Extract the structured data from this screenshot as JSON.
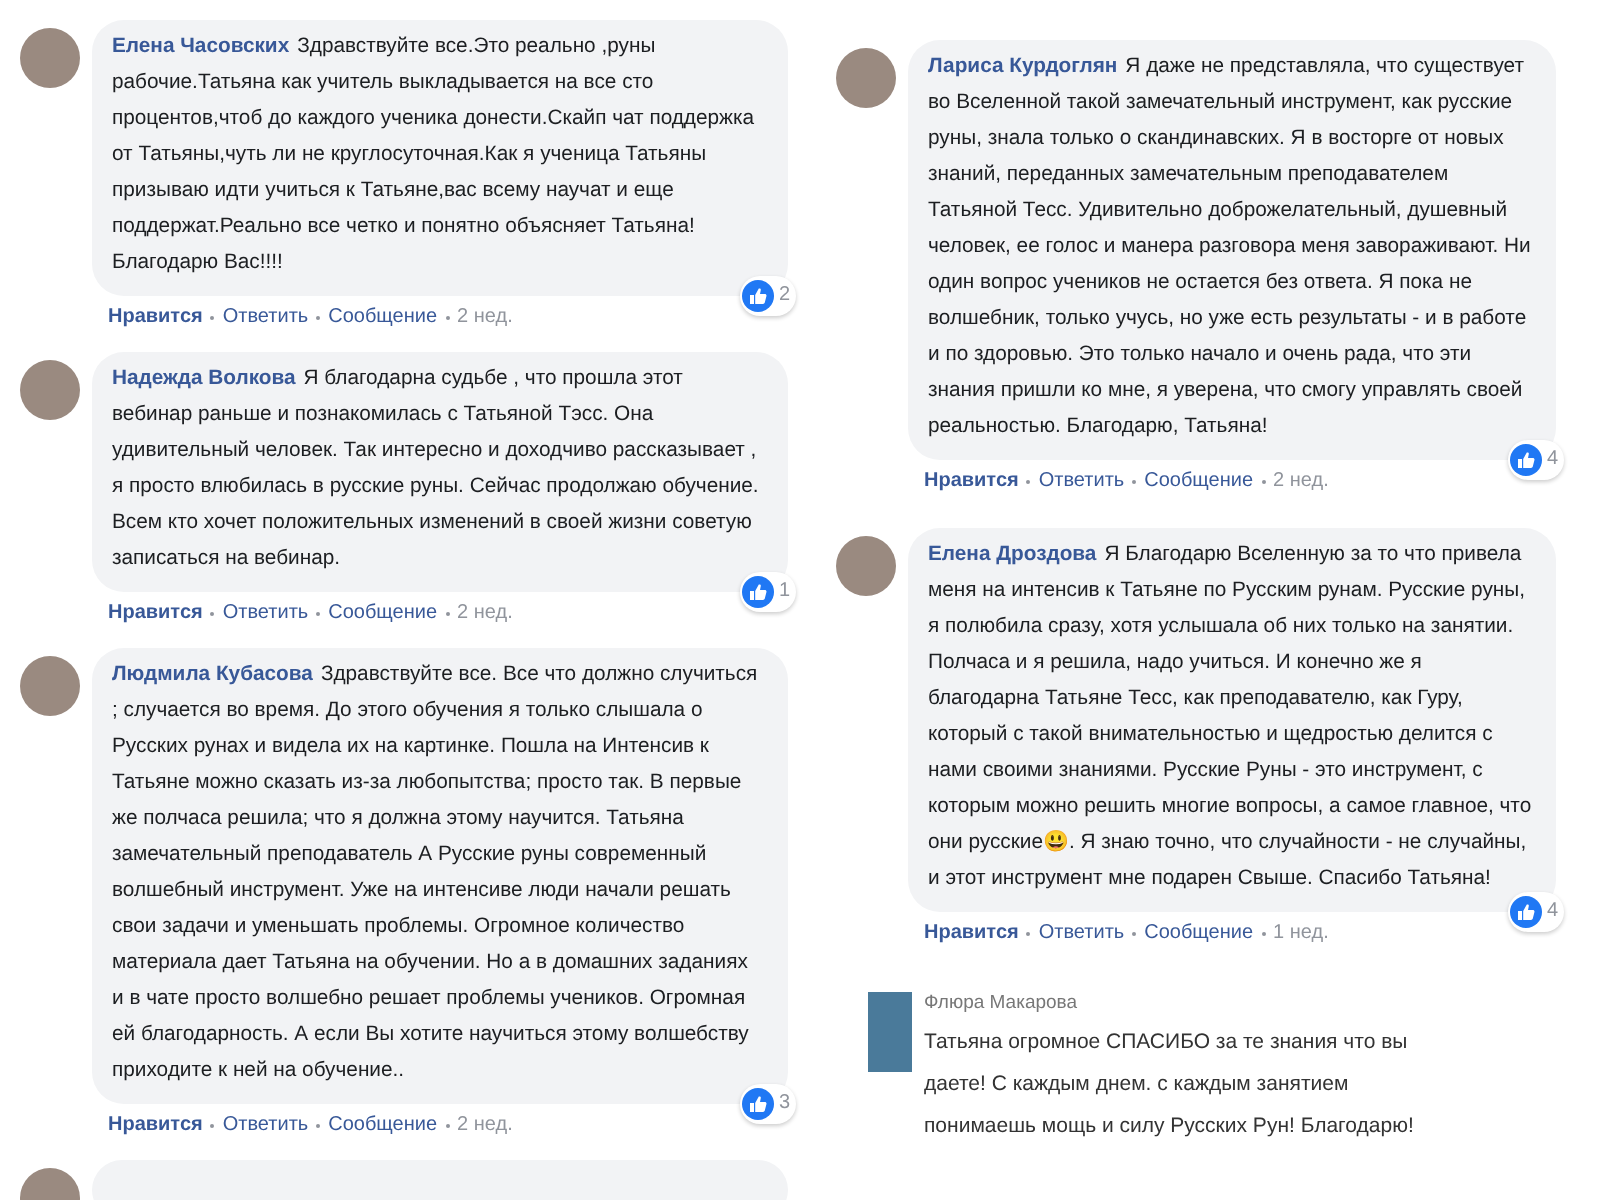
{
  "columns": [
    {
      "comments": [
        {
          "kind": "bubble",
          "author": "Елена Часовских",
          "text": "Здравствуйте все.Это реально ,руны рабочие.Татьяна как учитель выкладывается на все сто процентов,чтоб до каждого ученика донести.Скайп чат поддержка от Татьяны,чуть ли не круглосуточная.Как я ученица Татьяны призываю идти учиться к Татьяне,вас всему научат и еще поддержат.Реально все четко и понятно объясняет Татьяна! Благодарю Вас!!!!",
          "reactions": "2",
          "actions": [
            "Нравится",
            "Ответить",
            "Сообщение"
          ],
          "time": "2 нед."
        },
        {
          "kind": "bubble",
          "author": "Надежда Волкова",
          "text": "Я благодарна судьбе , что прошла этот вебинар раньше и познакомилась с Татьяной Тэсс. Она удивительный человек. Так интересно и доходчиво рассказывает , я просто влюбилась в русские руны. Сейчас продолжаю обучение. Всем кто хочет положительных изменений в своей жизни советую записаться на вебинар.",
          "reactions": "1",
          "actions": [
            "Нравится",
            "Ответить",
            "Сообщение"
          ],
          "time": "2 нед."
        },
        {
          "kind": "bubble",
          "author": "Людмила Кубасова",
          "text": "Здравствуйте все. Все что должно случиться ; случается во время. До этого обучения я только слышала о Русских рунах и видела их на картинке. Пошла на Интенсив к Татьяне можно сказать из-за любопытства; просто так. В первые же полчаса решила; что я должна этому научится. Татьяна замечательный преподаватель А Русские руны современный волшебный инструмент. Уже на интенсиве люди начали решать свои задачи и уменьшать проблемы. Огромное количество материала дает Татьяна на обучении. Но а в домашних заданиях и в чате просто волшебно решает проблемы учеников. Огромная ей благодарность. А если Вы хотите научиться этому волшебству приходите к ней на обучение..",
          "reactions": "3",
          "actions": [
            "Нравится",
            "Ответить",
            "Сообщение"
          ],
          "time": "2 нед."
        },
        {
          "kind": "cut"
        }
      ]
    },
    {
      "comments": [
        {
          "kind": "bubble",
          "author": "Лариса Курдоглян",
          "text": "Я даже не представляла, что существует во Вселенной такой замечательный инструмент, как русские руны, знала только о скандинавских. Я в восторге от новых знаний, переданных замечательным преподавателем Татьяной Тесс. Удивительно доброжелательный, душевный человек, ее голос и манера разговора меня завораживают. Ни один вопрос учеников не остается без ответа. Я пока не волшебник, только учусь, но уже есть результаты - и в работе и по здоровью. Это только начало и очень рада, что эти знания пришли ко мне, я уверена, что смогу управлять своей реальностью. Благодарю, Татьяна!",
          "reactions": "4",
          "actions": [
            "Нравится",
            "Ответить",
            "Сообщение"
          ],
          "time": "2 нед."
        },
        {
          "kind": "bubble",
          "author": "Елена Дроздова",
          "text": "Я Благодарю Вселенную за то что привела меня на интенсив к Татьяне по Русским рунам. Русские руны, я полюбила сразу, хотя услышала об них только на занятии. Полчаса и я решила, надо учиться. И конечно же я благодарна Татьяне Тесс, как преподавателю, как Гуру, который с такой внимательностью и щедростью делится с нами своими знаниями. Русские Руны - это инструмент, с которым можно решить многие вопросы, а самое главное, что они русские😃. Я знаю точно, что случайности - не случайны, и этот инструмент мне подарен Свыше. Спасибо Татьяна!",
          "reactions": "4",
          "actions": [
            "Нравится",
            "Ответить",
            "Сообщение"
          ],
          "time": "1 нед."
        },
        {
          "kind": "plain",
          "author": "Флюра Макарова",
          "text": "Татьяна огромное СПАСИБО за те знания что вы даете! С каждым днем. с каждым занятием понимаешь мощь и силу Русских Рун! Благодарю!"
        }
      ]
    }
  ]
}
